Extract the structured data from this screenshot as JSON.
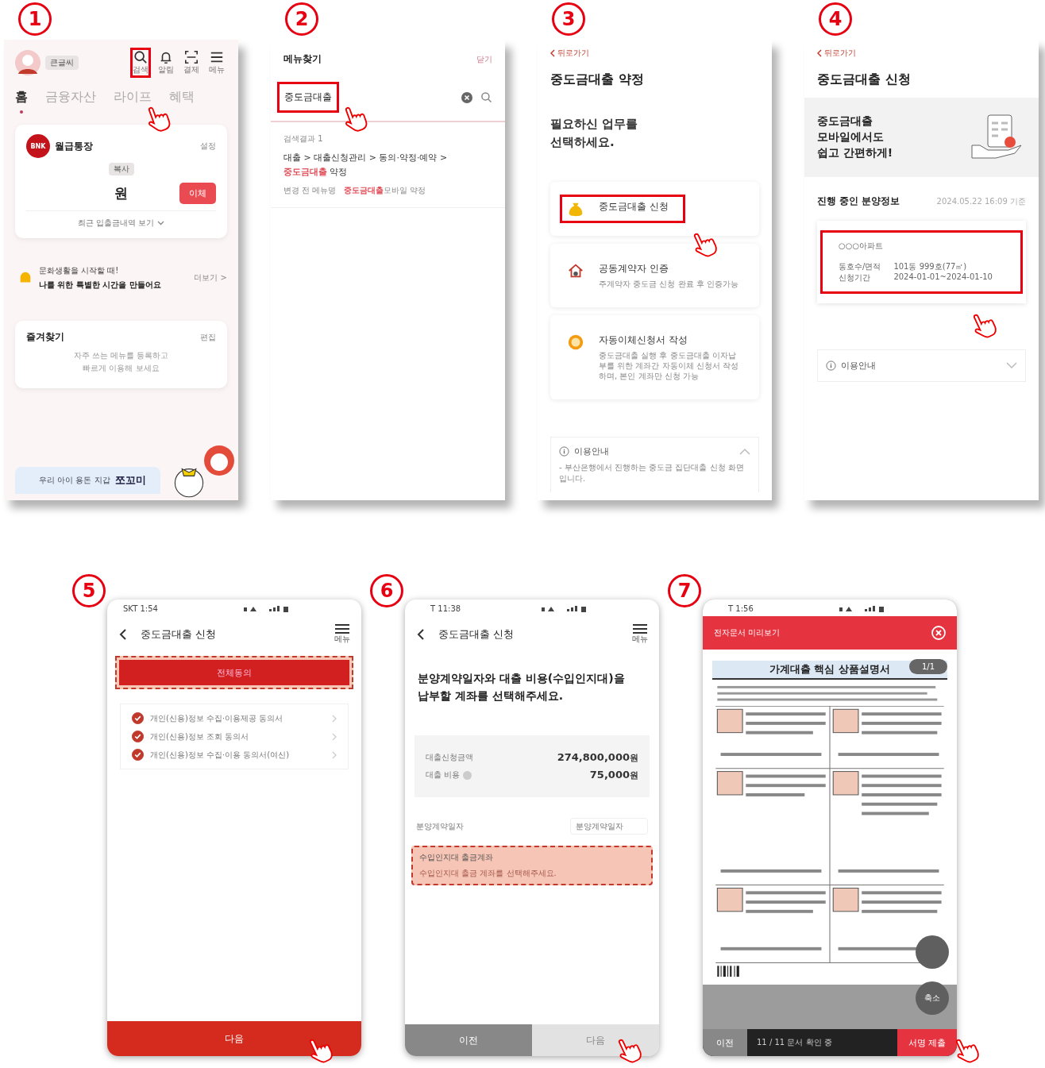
{
  "screen_1": {
    "step": "1",
    "profile_chip": "큰글씨",
    "header_icons": [
      {
        "kind": "search",
        "label": "검색",
        "highlighted": true
      },
      {
        "kind": "bell",
        "label": "알림"
      },
      {
        "kind": "scan",
        "label": "결제"
      },
      {
        "kind": "menu",
        "label": "메뉴"
      }
    ],
    "tabs": [
      {
        "label": "홈",
        "selected": true
      },
      {
        "label": "금융자산",
        "selected": false
      },
      {
        "label": "라이프",
        "selected": false
      },
      {
        "label": "혜택",
        "selected": false
      }
    ],
    "account": {
      "logo": "BNK",
      "name": "월급통장",
      "settings": "설정",
      "copy": "복사",
      "balance": "원",
      "transfer": "이체",
      "history": "최근 입출금내역 보기"
    },
    "promo": {
      "line_1": "문화생활을 시작할 때!",
      "line_2": "나를 위한 특별한 시간을 만들어요",
      "more": "더보기 >"
    },
    "favorites": {
      "title": "즐겨찾기",
      "edit": "편집",
      "hint_lines": [
        "자주 쓰는 메뉴를 등록하고",
        "빠르게 이용해 보세요"
      ]
    },
    "bottom_banner": {
      "caption": "우리 아이 용돈 지갑",
      "brand": "쪼꼬미"
    }
  },
  "screen_2": {
    "step": "2",
    "title": "메뉴찾기",
    "close": "닫기",
    "search": {
      "value": "중도금대출",
      "highlighted": true
    },
    "result_count": "검색결과 1",
    "result": {
      "path": "대출 > 대출신청관리 > 동의·약정·예약 >",
      "match": "중도금대출",
      "rest": "약정",
      "old_label": "변경 전 메뉴명",
      "old_match": "중도금대출",
      "old_rest": "모바일 약정"
    }
  },
  "screen_3": {
    "step": "3",
    "back": "뒤로가기",
    "title": "중도금대출 약정",
    "prompt_lines": [
      "필요하신 업무를",
      "선택하세요."
    ],
    "options": [
      {
        "kind": "bag",
        "title": "중도금대출 신청",
        "highlighted": true
      },
      {
        "kind": "house",
        "title": "공동계약자 인증",
        "desc": "주계약자 중도금 신청 완료 후 인증가능"
      },
      {
        "kind": "coin",
        "title": "자동이체신청서 작성",
        "desc": "중도금대출 실행 후 중도금대출 이자납부를 위한 계좌간 자동이체 신청서 작성하며, 본인 계좌만 신청 가능"
      }
    ],
    "info": {
      "title": "이용안내",
      "expanded": true,
      "text": "- 부산은행에서 진행하는 중도금 집단대출 신청 화면입니다."
    }
  },
  "screen_4": {
    "step": "4",
    "back": "뒤로가기",
    "title": "중도금대출 신청",
    "banner_lines": [
      "중도금대출",
      "모바일에서도",
      "쉽고 간편하게!"
    ],
    "section_title": "진행 중인 분양정보",
    "timestamp": "2024.05.22 16:09 기준",
    "complex": {
      "name": "○○○아파트",
      "highlighted": true,
      "rows": [
        {
          "label": "동호수/면적",
          "value": "101동 999호(77㎡)"
        },
        {
          "label": "신청기간",
          "value": "2024-01-01~2024-01-10"
        }
      ]
    },
    "info": {
      "title": "이용안내",
      "expanded": false
    }
  },
  "screen_5": {
    "step": "5",
    "status_time": "SKT 1:54",
    "title": "중도금대출 신청",
    "menu_label": "메뉴",
    "agree_all": {
      "label": "전체동의",
      "highlighted": true
    },
    "consents": [
      {
        "label": "개인(신용)정보 수집·이용제공 동의서",
        "checked": true
      },
      {
        "label": "개인(신용)정보 조회 동의서",
        "checked": true
      },
      {
        "label": "개인(신용)정보 수집·이용 동의서(여신)",
        "checked": true
      }
    ],
    "next": "다음"
  },
  "screen_6": {
    "step": "6",
    "status_time": "T 11:38",
    "title": "중도금대출 신청",
    "menu_label": "메뉴",
    "prompt_lines": [
      "분양계약일자와 대출 비용(수입인지대)을",
      "납부할 계좌를 선택해주세요."
    ],
    "summary": [
      {
        "label": "대출신청금액",
        "value": "274,800,000",
        "unit": "원"
      },
      {
        "label": "대출 비용",
        "value": "75,000",
        "unit": "원",
        "info": true
      }
    ],
    "contract_date": {
      "label": "분양계약일자",
      "placeholder": "분양계약일자"
    },
    "account_select": {
      "label": "수입인지대 출금계좌",
      "placeholder": "수입인지대 출금 계좌를 선택해주세요.",
      "highlighted": true
    },
    "buttons": [
      {
        "label": "이전",
        "disabled": false
      },
      {
        "label": "다음",
        "disabled": true
      }
    ]
  },
  "screen_7": {
    "step": "7",
    "status_time": "T 1:56",
    "header": "전자문서 미리보기",
    "document_title": "가계대출 핵심 상품설명서",
    "page_indicator": "1/1",
    "zoom_out": "축소",
    "prev": "이전",
    "progress": "11 / 11 문서 확인 중",
    "submit": "서명 제출"
  }
}
